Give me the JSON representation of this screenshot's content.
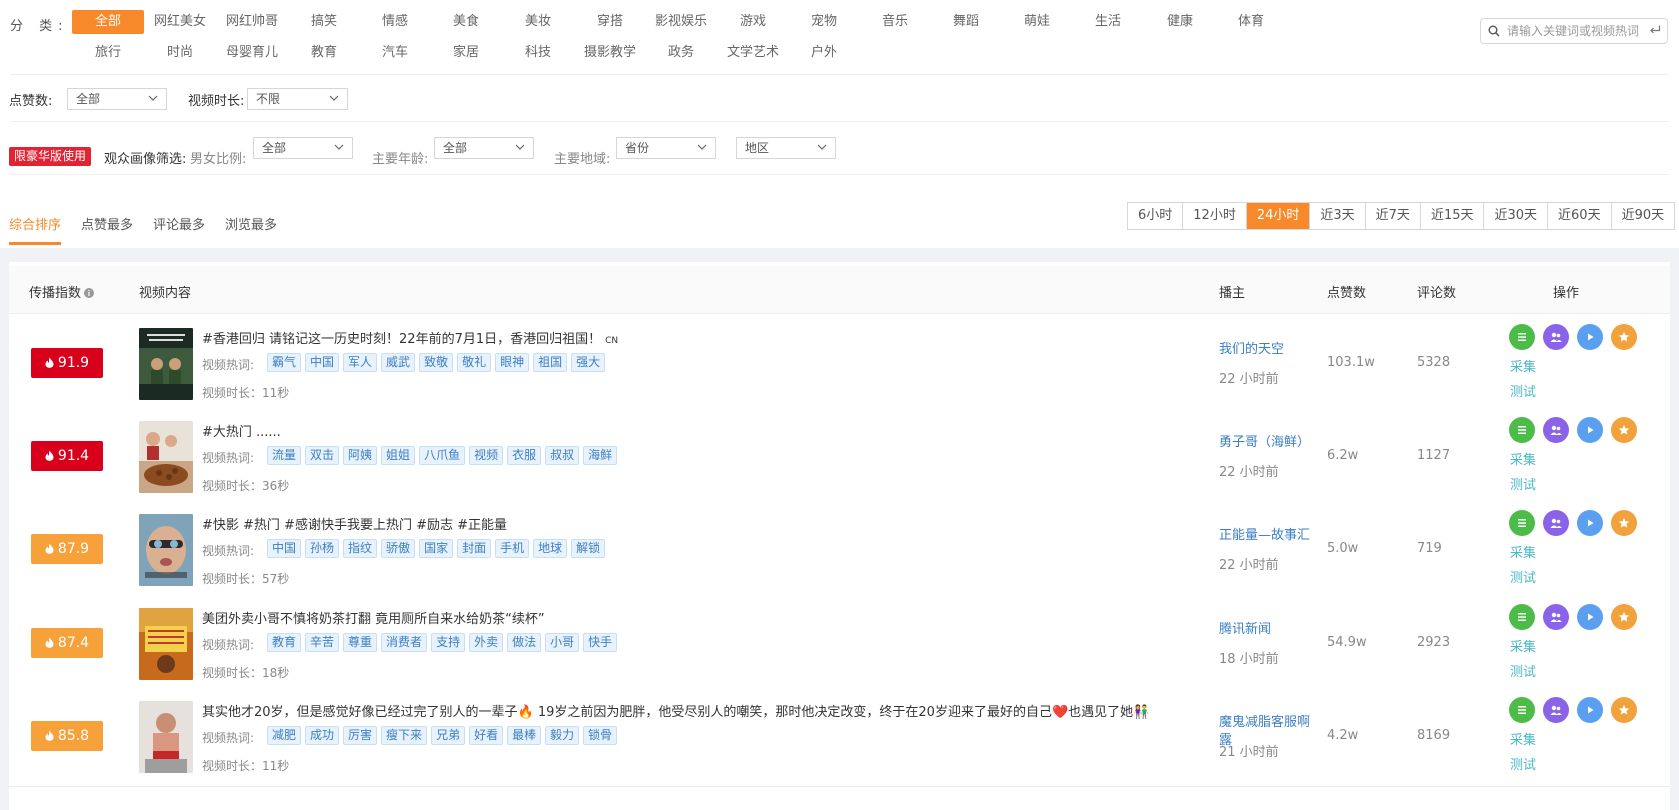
{
  "categories": {
    "label": "分 类:",
    "row1": [
      "全部",
      "网红美女",
      "网红帅哥",
      "搞笑",
      "情感",
      "美食",
      "美妆",
      "穿搭",
      "影视娱乐",
      "游戏",
      "宠物",
      "音乐",
      "舞蹈",
      "萌娃",
      "生活",
      "健康",
      "体育"
    ],
    "row2": [
      "旅行",
      "时尚",
      "母婴育儿",
      "教育",
      "汽车",
      "家居",
      "科技",
      "摄影教学",
      "政务",
      "文学艺术",
      "户外"
    ],
    "active": "全部"
  },
  "search": {
    "placeholder": "请输入关键词或视频热词"
  },
  "filters": {
    "likes_label": "点赞数:",
    "likes_value": "全部",
    "duration_label": "视频时长:",
    "duration_value": "不限",
    "premium_badge": "限豪华版使用",
    "audience_label": "观众画像筛选:",
    "gender_label": "男女比例:",
    "gender_value": "全部",
    "age_label": "主要年龄:",
    "age_value": "全部",
    "region_label": "主要地域:",
    "province_value": "省份",
    "area_value": "地区"
  },
  "sort_tabs": [
    "综合排序",
    "点赞最多",
    "评论最多",
    "浏览最多"
  ],
  "time_ranges": [
    "6小时",
    "12小时",
    "24小时",
    "近3天",
    "近7天",
    "近15天",
    "近30天",
    "近60天",
    "近90天"
  ],
  "active_time_range": "24小时",
  "table": {
    "headers": {
      "index": "传播指数",
      "content": "视频内容",
      "host": "播主",
      "likes": "点赞数",
      "comments": "评论数",
      "actions": "操作"
    },
    "tag_label": "视频热词:",
    "op_links": [
      "采集",
      "测试"
    ],
    "rows": [
      {
        "score": "91.9",
        "score_color": "#d9001b",
        "title": "#香港回归 请铭记这一历史时刻！22年前的7月1日，香港回归祖国！",
        "title_suffix": "CN",
        "tags": [
          "霸气",
          "中国",
          "军人",
          "威武",
          "致敬",
          "敬礼",
          "眼神",
          "祖国",
          "强大"
        ],
        "duration": "视频时长：11秒",
        "host": "我们的天空",
        "time": "22 小时前",
        "likes": "103.1w",
        "comments": "5328"
      },
      {
        "score": "91.4",
        "score_color": "#d9001b",
        "title": "#大热门 ......",
        "title_suffix": "",
        "tags": [
          "流量",
          "双击",
          "阿姨",
          "姐姐",
          "八爪鱼",
          "视频",
          "衣服",
          "叔叔",
          "海鲜"
        ],
        "duration": "视频时长：36秒",
        "host": "勇子哥（海鲜）",
        "time": "22 小时前",
        "likes": "6.2w",
        "comments": "1127"
      },
      {
        "score": "87.9",
        "score_color": "#f7a13b",
        "title": "#快影 #热门 #感谢快手我要上热门 #励志 #正能量",
        "title_suffix": "",
        "tags": [
          "中国",
          "孙杨",
          "指纹",
          "骄傲",
          "国家",
          "封面",
          "手机",
          "地球",
          "解锁"
        ],
        "duration": "视频时长：57秒",
        "host": "正能量—故事汇",
        "time": "22 小时前",
        "likes": "5.0w",
        "comments": "719"
      },
      {
        "score": "87.4",
        "score_color": "#f7a13b",
        "title": "美团外卖小哥不慎将奶茶打翻 竟用厕所自来水给奶茶“续杯”",
        "title_suffix": "",
        "tags": [
          "教育",
          "辛苦",
          "尊重",
          "消费者",
          "支持",
          "外卖",
          "做法",
          "小哥",
          "快手"
        ],
        "duration": "视频时长：18秒",
        "host": "腾讯新闻",
        "time": "18 小时前",
        "likes": "54.9w",
        "comments": "2923"
      },
      {
        "score": "85.8",
        "score_color": "#f7a13b",
        "title": "其实他才20岁，但是感觉好像已经过完了别人的一辈子🔥 19岁之前因为肥胖，他受尽别人的嘲笑，那时他决定改变，终于在20岁迎来了最好的自己❤️也遇见了她👫",
        "title_suffix": "",
        "tags": [
          "减肥",
          "成功",
          "厉害",
          "瘦下来",
          "兄弟",
          "好看",
          "最棒",
          "毅力",
          "锁骨"
        ],
        "duration": "视频时长：11秒",
        "host": "魔鬼减脂客服啊露",
        "time": "21 小时前",
        "likes": "4.2w",
        "comments": "8169"
      }
    ]
  },
  "colors": {
    "accent": "#f7892b",
    "link": "#3b7fc4",
    "danger": "#d9001b",
    "warn": "#f7a13b"
  }
}
